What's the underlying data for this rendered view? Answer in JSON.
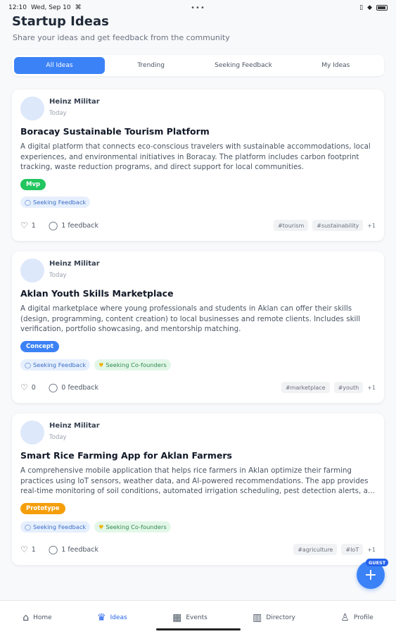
{
  "status_bar": {
    "time": "12:10",
    "date": "Wed, Sep 10",
    "center": "•••"
  },
  "page": {
    "title": "Startup Ideas",
    "subtitle": "Share your ideas and get feedback from the community"
  },
  "tabs": [
    {
      "label": "All Ideas",
      "active": true
    },
    {
      "label": "Trending",
      "active": false
    },
    {
      "label": "Seeking Feedback",
      "active": false
    },
    {
      "label": "My Ideas",
      "active": false
    }
  ],
  "ideas": [
    {
      "author": "Heinz Militar",
      "date": "Today",
      "title": "Boracay Sustainable Tourism Platform",
      "description": "A digital platform that connects eco-conscious travelers with sustainable accommodations, local experiences, and environmental initiatives in Boracay. The platform includes carbon footprint tracking, waste reduction programs, and direct support for local communities.",
      "stage": "Mvp",
      "badges": [
        "Seeking Feedback"
      ],
      "likes": "1",
      "feedback": "1 feedback",
      "tags": [
        "#tourism",
        "#sustainability"
      ],
      "more": "+1"
    },
    {
      "author": "Heinz Militar",
      "date": "Today",
      "title": "Aklan Youth Skills Marketplace",
      "description": "A digital marketplace where young professionals and students in Aklan can offer their skills (design, programming, content creation) to local businesses and remote clients. Includes skill verification, portfolio showcasing, and mentorship matching.",
      "stage": "Concept",
      "badges": [
        "Seeking Feedback",
        "Seeking Co-founders"
      ],
      "likes": "0",
      "feedback": "0 feedback",
      "tags": [
        "#marketplace",
        "#youth"
      ],
      "more": "+1"
    },
    {
      "author": "Heinz Militar",
      "date": "Today",
      "title": "Smart Rice Farming App for Aklan Farmers",
      "description": "A comprehensive mobile application that helps rice farmers in Aklan optimize their farming practices using IoT sensors, weather data, and AI-powered recommendations. The app provides real-time monitoring of soil conditions, automated irrigation scheduling, pest detection alerts, a...",
      "stage": "Prototype",
      "badges": [
        "Seeking Feedback",
        "Seeking Co-founders"
      ],
      "likes": "1",
      "feedback": "1 feedback",
      "tags": [
        "#agriculture",
        "#IoT"
      ],
      "more": "+1"
    }
  ],
  "fab": {
    "label": "+",
    "badge": "GUEST"
  },
  "nav": [
    {
      "label": "Home",
      "icon": "home-icon",
      "active": false
    },
    {
      "label": "Ideas",
      "icon": "trophy-icon",
      "active": true
    },
    {
      "label": "Events",
      "icon": "calendar-icon",
      "active": false
    },
    {
      "label": "Directory",
      "icon": "building-icon",
      "active": false
    },
    {
      "label": "Profile",
      "icon": "user-icon",
      "active": false
    }
  ],
  "colors": {
    "accent": "#3b82f6",
    "mvp": "#22c55e",
    "concept": "#3b82f6",
    "prototype": "#f59e0b"
  }
}
